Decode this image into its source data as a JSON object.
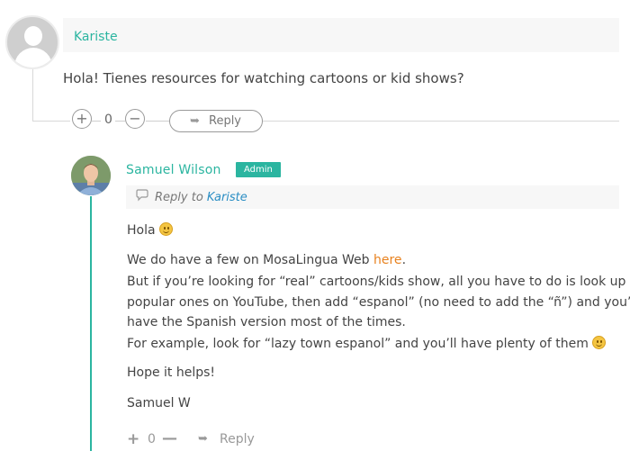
{
  "parent_comment": {
    "author": "Kariste",
    "text": "Hola! Tienes resources for watching cartoons or kid shows?",
    "vote_count": "0",
    "reply_label": "Reply",
    "avatar_icon": "default-user-avatar"
  },
  "reply_comment": {
    "author": "Samuel Wilson",
    "badge": "Admin",
    "reply_to_prefix": "Reply to",
    "reply_to_name": "Kariste",
    "greeting": "Hola",
    "line1_prefix": "We do have a few on MosaLingua Web ",
    "line1_link": "here",
    "line1_suffix": ".",
    "line2": "But if you’re looking for “real” cartoons/kids show, all you have to do is look up",
    "line3": "popular ones on YouTube, then add “espanol” (no need to add the “ñ”) and you’ll",
    "line4": "have the Spanish version most of the times.",
    "line5": "For example, look for “lazy town espanol” and you’ll have plenty of them",
    "closing": "Hope it helps!",
    "signature": "Samuel W",
    "vote_count": "0",
    "reply_label": "Reply"
  },
  "colors": {
    "accent": "#2bb5a0",
    "link": "#e8821f",
    "reply_to_link": "#2b8ec4",
    "text": "#444444"
  }
}
